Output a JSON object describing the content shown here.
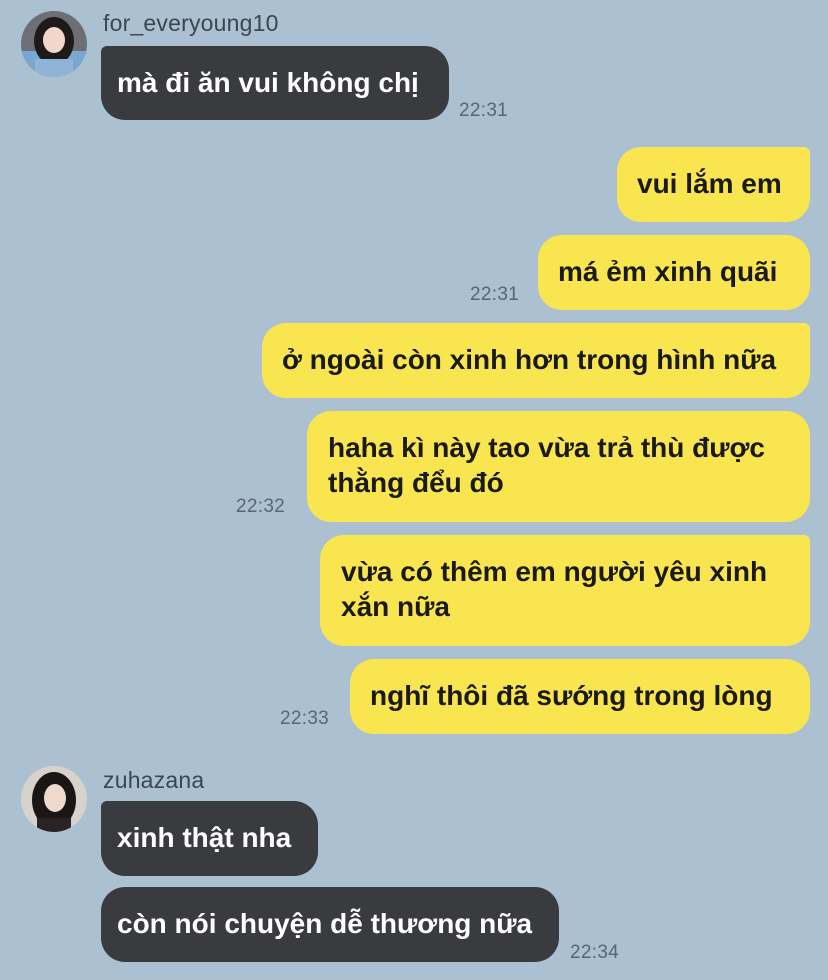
{
  "messages": {
    "g1": {
      "username": "for_everyoung10",
      "m1": "mà đi ăn vui không chị",
      "time": "22:31"
    },
    "mine": {
      "m1": "vui lắm em",
      "m2": "má ẻm xinh quãi",
      "time1": "22:31",
      "m3": "ở ngoài còn xinh hơn trong hình nữa",
      "m4": "haha kì này tao vừa trả thù được thằng đểu đó",
      "time2": "22:32",
      "m5": "vừa có thêm em người yêu xinh xắn nữa",
      "m6": "nghĩ thôi đã sướng trong lòng",
      "time3": "22:33"
    },
    "g2": {
      "username": "zuhazana",
      "m1": "xinh thật nha",
      "m2": "còn nói chuyện dễ thương nữa",
      "time": "22:34"
    }
  },
  "colors": {
    "background": "#abc1d1",
    "incoming_bubble": "#3a3b3e",
    "outgoing_bubble": "#f9e54f"
  }
}
